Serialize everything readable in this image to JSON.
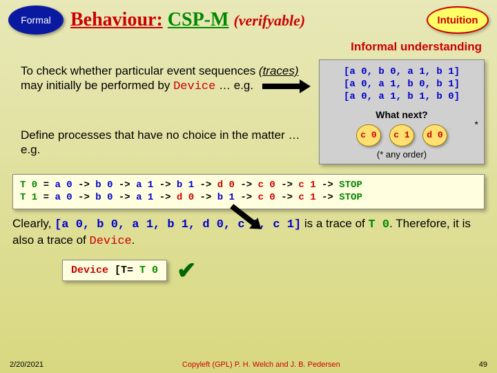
{
  "header": {
    "formal_label": "Formal",
    "title_behaviour": "Behaviour:",
    "title_csp": "CSP-M",
    "title_verifyable": "(verifyable)",
    "intuition_label": "Intuition"
  },
  "informal_label": "Informal understanding",
  "para1_a": "To check whether particular event sequences ",
  "para1_traces": "(traces)",
  "para1_b": " may initially be performed by ",
  "para1_device": "Device",
  "para1_c": " … e.g.",
  "para2": "Define processes that have no choice in the matter … e.g.",
  "right": {
    "traces": "[a 0, b 0, a 1, b 1]\n[a 0, a 1, b 0, b 1]\n[a 0, a 1, b 1, b 0]",
    "whatnext": "What next?",
    "c0": "c 0",
    "c1": "c 1",
    "d0": "d 0",
    "star": "*",
    "anyorder": "(* any order)"
  },
  "code": {
    "t0_lhs": "T 0",
    "t1_lhs": "T 1",
    "eq": " = ",
    "arrow": " -> ",
    "a0": "a 0",
    "b0": "b 0",
    "a1": "a 1",
    "b1": "b 1",
    "d0": "d 0",
    "c0": "c 0",
    "c1": "c 1",
    "stop": "STOP"
  },
  "clearly_a": "Clearly, ",
  "clearly_trace": "[a 0, b 0, a 1, b 1, d 0, c 0, c 1]",
  "clearly_b": " is a trace of ",
  "clearly_t0": "T 0",
  "clearly_c": ". Therefore, it is also a trace of ",
  "clearly_device": "Device",
  "clearly_d": ".",
  "refine": {
    "device": "Device",
    "op": " [T= ",
    "t0": "T 0"
  },
  "footer": {
    "date": "2/20/2021",
    "copyleft": "Copyleft (GPL) P. H. Welch and J. B. Pedersen",
    "page": "49"
  }
}
